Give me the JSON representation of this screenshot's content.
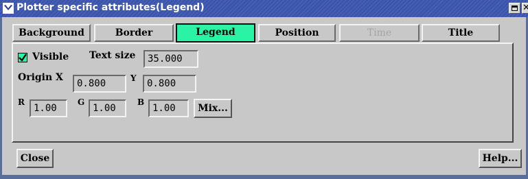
{
  "window": {
    "title": "Plotter specific attributes(Legend)",
    "icons": [
      "chevron-down-icon",
      "maximize-icon",
      "close-icon"
    ]
  },
  "tabs": [
    {
      "label": "Background",
      "state": "normal"
    },
    {
      "label": "Border",
      "state": "normal"
    },
    {
      "label": "Legend",
      "state": "active"
    },
    {
      "label": "Position",
      "state": "normal"
    },
    {
      "label": "Time",
      "state": "disabled"
    },
    {
      "label": "Title",
      "state": "normal"
    }
  ],
  "legend": {
    "visible_label": "Visible",
    "visible_checked": true,
    "text_size_label": "Text size",
    "text_size_value": "35.000",
    "origin_x_label": "Origin X",
    "origin_x_value": "0.800",
    "origin_y_label": "Y",
    "origin_y_value": "0.800",
    "r_label": "R",
    "r_value": "1.00",
    "g_label": "G",
    "g_value": "1.00",
    "b_label": "B",
    "b_value": "1.00",
    "mix_label": "Mix..."
  },
  "buttons": {
    "close_label": "Close",
    "help_label": "Help..."
  },
  "colors": {
    "titlebar": "#3b55ad",
    "active_tab": "#2bf3a5",
    "background": "#c8c8c8"
  }
}
